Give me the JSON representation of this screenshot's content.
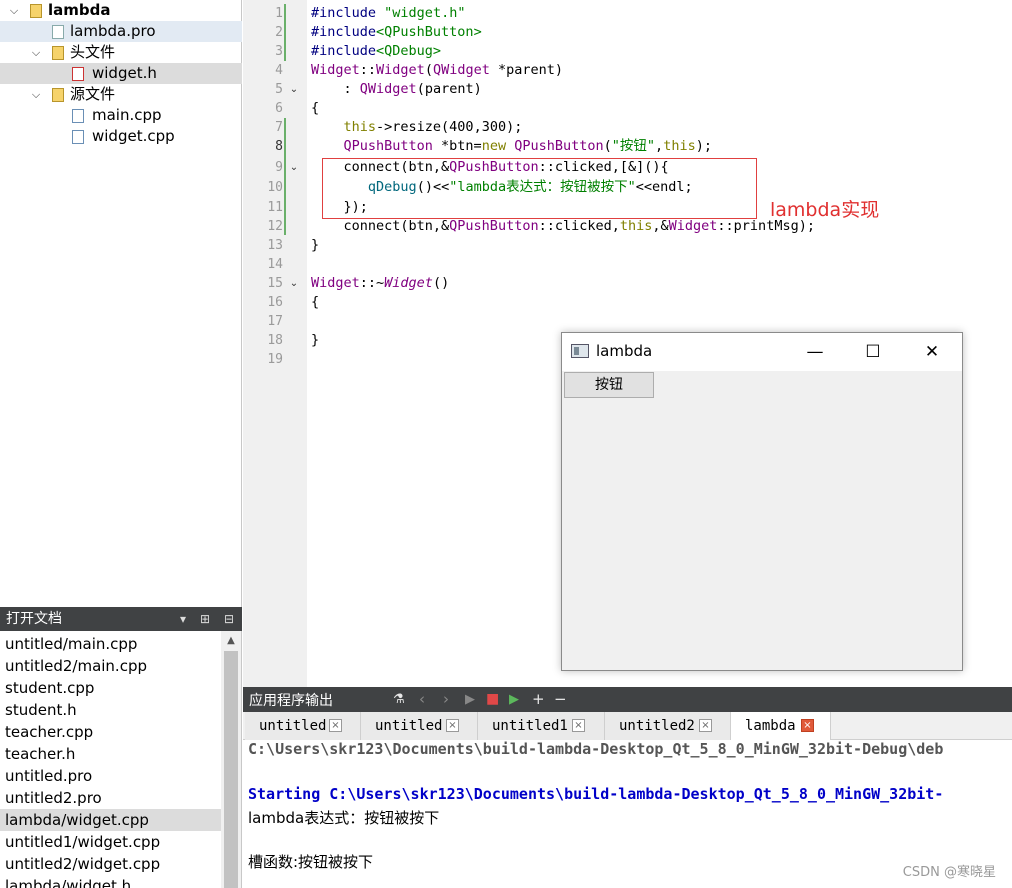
{
  "project_tree": {
    "root": "lambda",
    "pro_file": "lambda.pro",
    "headers_folder": "头文件",
    "header_file": "widget.h",
    "sources_folder": "源文件",
    "source_files": [
      "main.cpp",
      "widget.cpp"
    ]
  },
  "open_documents": {
    "title": "打开文档",
    "items": [
      "untitled/main.cpp",
      "untitled2/main.cpp",
      "student.cpp",
      "student.h",
      "teacher.cpp",
      "teacher.h",
      "untitled.pro",
      "untitled2.pro",
      "lambda/widget.cpp",
      "untitled1/widget.cpp",
      "untitled2/widget.cpp",
      "lambda/widget.h"
    ],
    "current_index": 8
  },
  "editor": {
    "line_numbers": [
      "1",
      "2",
      "3",
      "4",
      "5",
      "6",
      "7",
      "8",
      "9",
      "10",
      "11",
      "12",
      "13",
      "14",
      "15",
      "16",
      "17",
      "18",
      "19"
    ],
    "active_line": "8",
    "annotation": "lambda实现"
  },
  "app_window": {
    "title": "lambda",
    "minimize": "—",
    "maximize": "☐",
    "close": "✕",
    "button_label": "按钮"
  },
  "output": {
    "title": "应用程序输出",
    "tabs": [
      "untitled",
      "untitled",
      "untitled1",
      "untitled2",
      "lambda"
    ],
    "active_tab": 4,
    "lines": {
      "path": "C:\\Users\\skr123\\Documents\\build-lambda-Desktop_Qt_5_8_0_MinGW_32bit-Debug\\deb",
      "starting": "Starting C:\\Users\\skr123\\Documents\\build-lambda-Desktop_Qt_5_8_0_MinGW_32bit-",
      "msg1": "lambda表达式：按钮被按下",
      "msg2": "槽函数:按钮被按下"
    }
  },
  "watermark": "CSDN @寒晓星",
  "colors": {
    "annotation": "#e03030",
    "keyword": "#808000",
    "type": "#800080",
    "string": "#008000"
  }
}
